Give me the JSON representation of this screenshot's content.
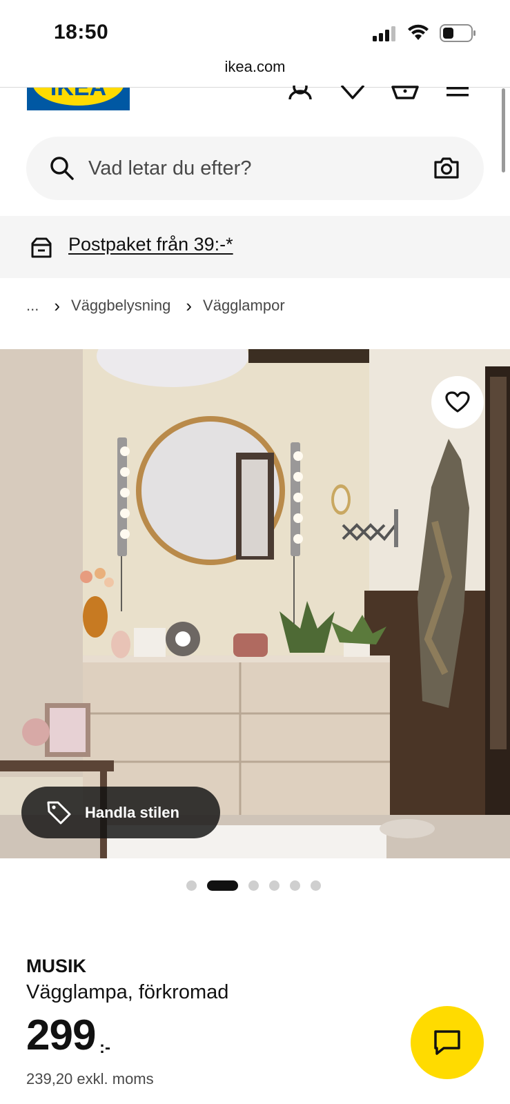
{
  "status_bar": {
    "time": "18:50"
  },
  "browser": {
    "url": "ikea.com"
  },
  "header": {
    "logo_text": "IKEA"
  },
  "search": {
    "placeholder": "Vad letar du efter?"
  },
  "promo": {
    "text": "Postpaket från 39:-*"
  },
  "breadcrumb": {
    "items": [
      "...",
      "Väggbelysning",
      "Vägglampor"
    ]
  },
  "hero": {
    "shop_style_label": "Handla stilen",
    "slide_count": 6,
    "active_slide": 2
  },
  "product": {
    "brand": "MUSIK",
    "description": "Vägglampa, förkromad",
    "price": "299",
    "price_suffix": ":-",
    "price_excl_vat": "239,20 exkl. moms"
  },
  "colors": {
    "brand_blue": "#0058a3",
    "brand_yellow": "#ffdb00"
  }
}
